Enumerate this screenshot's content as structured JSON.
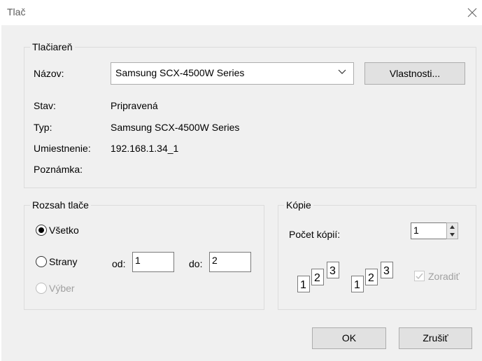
{
  "window": {
    "title": "Tlač"
  },
  "printer_group": {
    "legend": "Tlačiareň",
    "name_label": "Názov:",
    "name_value": "Samsung SCX-4500W Series",
    "properties_button": "Vlastnosti...",
    "status_label": "Stav:",
    "status_value": "Pripravená",
    "type_label": "Typ:",
    "type_value": "Samsung SCX-4500W Series",
    "location_label": "Umiestnenie:",
    "location_value": "192.168.1.34_1",
    "comment_label": "Poznámka:"
  },
  "range_group": {
    "legend": "Rozsah tlače",
    "all_label": "Všetko",
    "pages_label": "Strany",
    "from_label": "od:",
    "from_value": "1",
    "to_label": "do:",
    "to_value": "2",
    "selection_label": "Výber",
    "selected_option": "all"
  },
  "copies_group": {
    "legend": "Kópie",
    "count_label": "Počet kópií:",
    "count_value": "1",
    "page_numbers": [
      "1",
      "2",
      "3"
    ],
    "collate_label": "Zoradiť",
    "collate_checked": true,
    "collate_enabled": false
  },
  "buttons": {
    "ok": "OK",
    "cancel": "Zrušiť"
  }
}
